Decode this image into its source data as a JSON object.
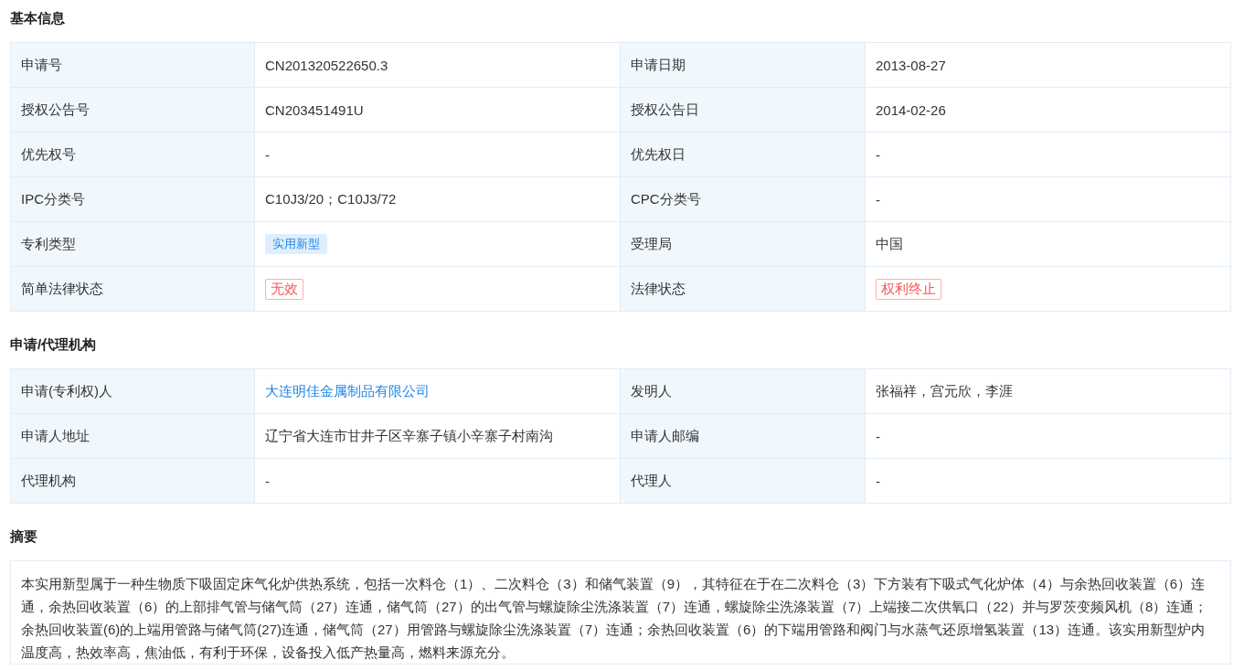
{
  "sections": [
    {
      "title": "基本信息",
      "kind": "table",
      "rows": [
        [
          {
            "label": "申请号",
            "value": {
              "kind": "text",
              "text": "CN201320522650.3"
            }
          },
          {
            "label": "申请日期",
            "value": {
              "kind": "text",
              "text": "2013-08-27"
            }
          }
        ],
        [
          {
            "label": "授权公告号",
            "value": {
              "kind": "text",
              "text": "CN203451491U"
            }
          },
          {
            "label": "授权公告日",
            "value": {
              "kind": "text",
              "text": "2014-02-26"
            }
          }
        ],
        [
          {
            "label": "优先权号",
            "value": {
              "kind": "text",
              "text": "-"
            }
          },
          {
            "label": "优先权日",
            "value": {
              "kind": "text",
              "text": "-"
            }
          }
        ],
        [
          {
            "label": "IPC分类号",
            "value": {
              "kind": "text",
              "text": "C10J3/20；C10J3/72"
            }
          },
          {
            "label": "CPC分类号",
            "value": {
              "kind": "text",
              "text": "-"
            }
          }
        ],
        [
          {
            "label": "专利类型",
            "value": {
              "kind": "tag",
              "text": "实用新型"
            }
          },
          {
            "label": "受理局",
            "value": {
              "kind": "text",
              "text": "中国"
            }
          }
        ],
        [
          {
            "label": "简单法律状态",
            "value": {
              "kind": "status",
              "text": "无效"
            }
          },
          {
            "label": "法律状态",
            "value": {
              "kind": "status",
              "text": "权利终止"
            }
          }
        ]
      ]
    },
    {
      "title": "申请/代理机构",
      "kind": "table",
      "rows": [
        [
          {
            "label": "申请(专利权)人",
            "value": {
              "kind": "link",
              "text": "大连明佳金属制品有限公司"
            }
          },
          {
            "label": "发明人",
            "value": {
              "kind": "text",
              "text": "张福祥，宫元欣，李涯"
            }
          }
        ],
        [
          {
            "label": "申请人地址",
            "value": {
              "kind": "text",
              "text": "辽宁省大连市甘井子区辛寨子镇小辛寨子村南沟"
            }
          },
          {
            "label": "申请人邮编",
            "value": {
              "kind": "text",
              "text": "-"
            }
          }
        ],
        [
          {
            "label": "代理机构",
            "value": {
              "kind": "text",
              "text": "-"
            }
          },
          {
            "label": "代理人",
            "value": {
              "kind": "text",
              "text": "-"
            }
          }
        ]
      ]
    },
    {
      "title": "摘要",
      "kind": "text",
      "text": "本实用新型属于一种生物质下吸固定床气化炉供热系统，包括一次料仓（1）、二次料仓（3）和储气装置（9），其特征在于在二次料仓（3）下方装有下吸式气化炉体（4）与余热回收装置（6）连通，余热回收装置（6）的上部排气管与储气筒（27）连通，储气筒（27）的出气管与螺旋除尘洗涤装置（7）连通，螺旋除尘洗涤装置（7）上端接二次供氧口（22）并与罗茨变频风机（8）连通；余热回收装置(6)的上端用管路与储气筒(27)连通，储气筒（27）用管路与螺旋除尘洗涤装置（7）连通；余热回收装置（6）的下端用管路和阀门与水蒸气还原增氢装置（13）连通。该实用新型炉内温度高，热效率高，焦油低，有利于环保，设备投入低产热量高，燃料来源充分。"
    }
  ]
}
